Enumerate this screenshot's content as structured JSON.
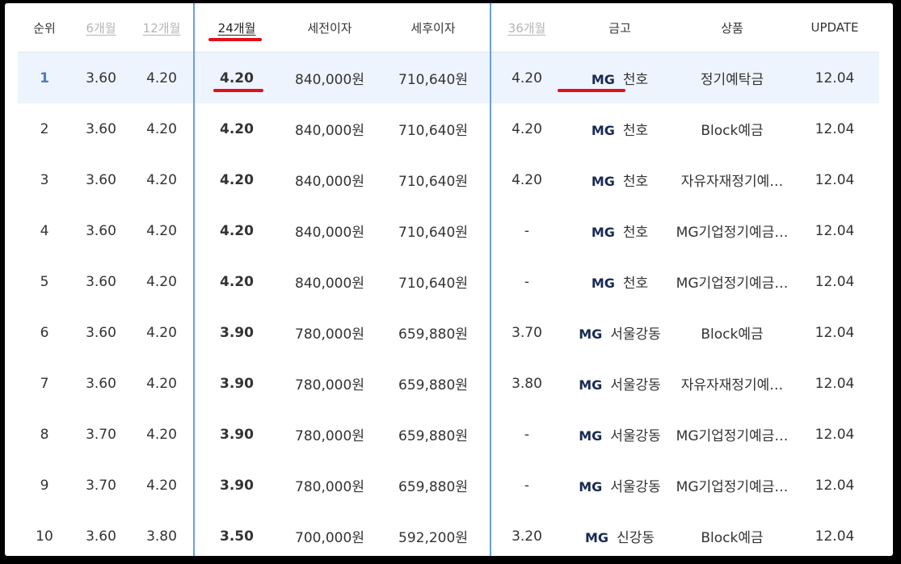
{
  "headers": {
    "rank": "순위",
    "m6": "6개월",
    "m12": "12개월",
    "m24": "24개월",
    "pretax": "세전이자",
    "aftertax": "세후이자",
    "m36": "36개월",
    "bank": "금고",
    "product": "상품",
    "update": "UPDATE"
  },
  "brand_label": "MG",
  "colors": {
    "rate24": "#b1264e",
    "divider": "#6a9ee4",
    "highlight_row": "#eef4fd",
    "annotation": "#e0101a",
    "brand": "#1a2a55"
  },
  "rows": [
    {
      "rank": "1",
      "m6": "3.60",
      "m12": "4.20",
      "m24": "4.20",
      "pretax": "840,000원",
      "aftertax": "710,640원",
      "m36": "4.20",
      "bank": "천호",
      "product": "정기예탁금",
      "update": "12.04"
    },
    {
      "rank": "2",
      "m6": "3.60",
      "m12": "4.20",
      "m24": "4.20",
      "pretax": "840,000원",
      "aftertax": "710,640원",
      "m36": "4.20",
      "bank": "천호",
      "product": "Block예금",
      "update": "12.04"
    },
    {
      "rank": "3",
      "m6": "3.60",
      "m12": "4.20",
      "m24": "4.20",
      "pretax": "840,000원",
      "aftertax": "710,640원",
      "m36": "4.20",
      "bank": "천호",
      "product": "자유자재정기예…",
      "update": "12.04"
    },
    {
      "rank": "4",
      "m6": "3.60",
      "m12": "4.20",
      "m24": "4.20",
      "pretax": "840,000원",
      "aftertax": "710,640원",
      "m36": "-",
      "bank": "천호",
      "product": "MG기업정기예금…",
      "update": "12.04"
    },
    {
      "rank": "5",
      "m6": "3.60",
      "m12": "4.20",
      "m24": "4.20",
      "pretax": "840,000원",
      "aftertax": "710,640원",
      "m36": "-",
      "bank": "천호",
      "product": "MG기업정기예금…",
      "update": "12.04"
    },
    {
      "rank": "6",
      "m6": "3.60",
      "m12": "4.20",
      "m24": "3.90",
      "pretax": "780,000원",
      "aftertax": "659,880원",
      "m36": "3.70",
      "bank": "서울강동",
      "product": "Block예금",
      "update": "12.04"
    },
    {
      "rank": "7",
      "m6": "3.60",
      "m12": "4.20",
      "m24": "3.90",
      "pretax": "780,000원",
      "aftertax": "659,880원",
      "m36": "3.80",
      "bank": "서울강동",
      "product": "자유자재정기예…",
      "update": "12.04"
    },
    {
      "rank": "8",
      "m6": "3.70",
      "m12": "4.20",
      "m24": "3.90",
      "pretax": "780,000원",
      "aftertax": "659,880원",
      "m36": "-",
      "bank": "서울강동",
      "product": "MG기업정기예금…",
      "update": "12.04"
    },
    {
      "rank": "9",
      "m6": "3.70",
      "m12": "4.20",
      "m24": "3.90",
      "pretax": "780,000원",
      "aftertax": "659,880원",
      "m36": "-",
      "bank": "서울강동",
      "product": "MG기업정기예금…",
      "update": "12.04"
    },
    {
      "rank": "10",
      "m6": "3.60",
      "m12": "3.80",
      "m24": "3.50",
      "pretax": "700,000원",
      "aftertax": "592,200원",
      "m36": "3.20",
      "bank": "신강동",
      "product": "Block예금",
      "update": "12.04"
    }
  ]
}
